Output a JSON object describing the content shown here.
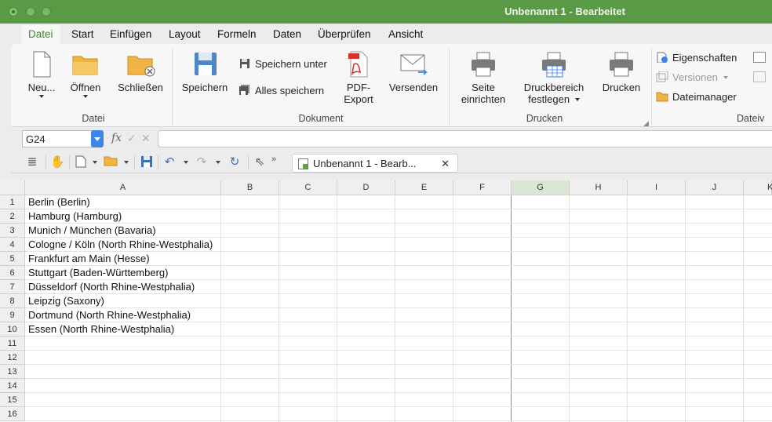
{
  "window": {
    "title": "Unbenannt 1 - Bearbeitet"
  },
  "menu_tabs": [
    "Datei",
    "Start",
    "Einfügen",
    "Layout",
    "Formeln",
    "Daten",
    "Überprüfen",
    "Ansicht"
  ],
  "ribbon": {
    "groups": {
      "datei": "Datei",
      "dokument": "Dokument",
      "drucken": "Drucken",
      "dateiv": "Dateiv"
    },
    "buttons": {
      "neu": "Neu...",
      "oeffnen": "Öffnen",
      "schliessen": "Schließen",
      "speichern": "Speichern",
      "speichern_unter": "Speichern unter",
      "alles_speichern": "Alles speichern",
      "pdf_line1": "PDF-",
      "pdf_line2": "Export",
      "versenden": "Versenden",
      "seite_line1": "Seite",
      "seite_line2": "einrichten",
      "druckbereich_line1": "Druckbereich",
      "druckbereich_line2": "festlegen",
      "drucken": "Drucken",
      "eigenschaften": "Eigenschaften",
      "versionen": "Versionen",
      "dateimanager": "Dateimanager"
    }
  },
  "formula_bar": {
    "cell_ref": "G24",
    "fx": "fx",
    "accept": "✓",
    "cancel": "✕"
  },
  "toolbar": {
    "document_tab": "Unbenannt 1 - Bearb...",
    "close": "✕"
  },
  "sheet": {
    "columns": [
      "A",
      "B",
      "C",
      "D",
      "E",
      "F",
      "G",
      "H",
      "I",
      "J",
      "K"
    ],
    "selected_column": "G",
    "rows": [
      "1",
      "2",
      "3",
      "4",
      "5",
      "6",
      "7",
      "8",
      "9",
      "10",
      "11",
      "12",
      "13",
      "14",
      "15",
      "16"
    ],
    "column_a": [
      "Berlin (Berlin)",
      "Hamburg (Hamburg)",
      "Munich / München (Bavaria)",
      "Cologne / Köln (North Rhine-Westphalia)",
      "Frankfurt am Main (Hesse)",
      "Stuttgart (Baden-Württemberg)",
      "Düsseldorf (North Rhine-Westphalia)",
      "Leipzig (Saxony)",
      "Dortmund (North Rhine-Westphalia)",
      "Essen (North Rhine-Westphalia)"
    ]
  },
  "colors": {
    "titlebar": "#5a9a45",
    "accent": "#3a8a2c",
    "selected_col": "#dbe7d5"
  }
}
